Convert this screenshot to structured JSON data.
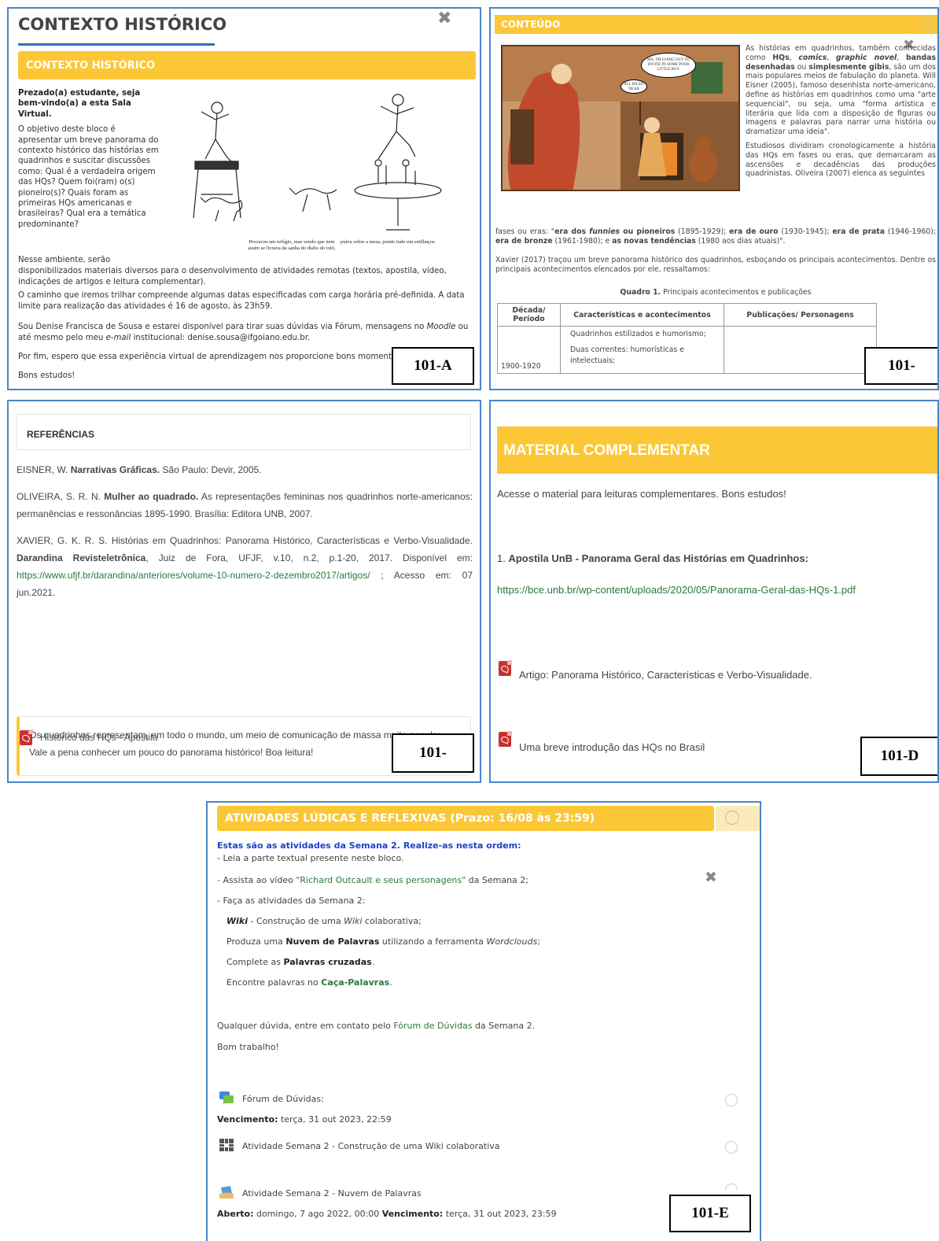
{
  "panel_a": {
    "heading": "CONTEXTO HISTÓRICO",
    "bar_title": "CONTEXTO HISTÓRICO",
    "greeting": "Prezado(a) estudante, seja bem-vindo(a) a esta Sala Virtual.",
    "intro": "O objetivo deste bloco é apresentar um breve panorama do contexto histórico das histórias em quadrinhos e suscitar discussões como: Qual é a verdadeira origem das HQs? Quem foi(ram) o(s) pioneiro(s)? Quais foram as primeiras HQs americanas e brasileiras? Qual era a temática predominante?",
    "para_env_a": "Nesse ambiente, serão",
    "para_env_b": "disponibilizados materiais diversos para o desenvolvimento de atividades remotas (textos, apostila, vídeo, indicações de artigos e leitura complementar).",
    "para_path": "O caminho que iremos trilhar compreende algumas datas especificadas  com carga horária pré-definida. A data limite para realização das atividades é 16 de agosto, às 23h59.",
    "para_me_a": "Sou Denise Francisca de Sousa e estarei disponível para tirar suas dúvidas via Fórum, mensagens no ",
    "para_me_moodle": "Moodle",
    "para_me_b": " ou até mesmo pelo meu ",
    "para_me_email": "e-mail",
    "para_me_c": " institucional: denise.sousa@ifgoiano.edu.br.",
    "para_end": "Por fim, espero que essa experiência virtual de aprendizagem nos proporcione bons momentos.",
    "para_bye": "Bons estudos!",
    "caption_left": "Procurou um refúgio, mas vendo que nem assim se livrava da sanha do diabo do totó,",
    "caption_right": "pulou sobre a mesa, pondo tudo em estilhaços.",
    "tag": "101-A"
  },
  "panel_b": {
    "bar_title": "CONTEÚDO",
    "comic_bubble1": "MA. I'M GOING OUT TO INVITE IN SOME POOR LITTLE BOY.",
    "comic_bubble2": "ALL RIGHT DEAR",
    "p1_a": "As histórias em quadrinhos, também conhecidas como ",
    "p1_hqs": "HQs",
    "p1_comics": "comics",
    "p1_gn": "graphic novel",
    "p1_bd": "bandas desenhadas",
    "p1_or": " ou ",
    "p1_gibis": "simplesmente gibis",
    "p1_b": ", são um dos mais populares meios de fabulação do planeta. Will Eisner (2005), famoso desenhista norte-americano, define as histórias em quadrinhos como uma \"arte sequencial\", ou seja, uma \"forma artística e literária que lida com a disposição de figuras ou imagens e palavras para narrar uma história ou dramatizar uma ideia\".",
    "p2": "Estudiosos dividiram cronologicamente a história das HQs em fases ou eras, que demarcaram as ascensões e decadências das produções quadrinistas. Oliveira (2007) elenca as seguintes",
    "p3_a": "fases ou eras: \"",
    "p3_era1": "era dos ",
    "p3_funnies": "funnies",
    "p3_era1b": " ou pioneiros",
    "p3_y1": " (1895-1929); ",
    "p3_ouro": "era de ouro",
    "p3_y2": " (1930-1945); ",
    "p3_prata": "era de prata",
    "p3_y3": " (1946-1960); ",
    "p3_bronze_a": "era de bronze",
    "p3_y4": " (1961-1980); e ",
    "p3_novas": "as novas tendências",
    "p3_y5": " (1980 aos dias atuais)\".",
    "p4": "Xavier (2017) traçou um breve panorama histórico dos quadrinhos, esboçando os principais acontecimentos. Dentre os principais acontecimentos elencados por ele, ressaltamos:",
    "quadro_label": "Quadro 1.",
    "quadro_title": " Principais acontecimentos e publicações",
    "table_headers": [
      "Década/ Período",
      "Características e acontecimentos",
      "Publicações/ Personagens"
    ],
    "table_period": "1900-1920",
    "table_items": [
      "Quadrinhos estilizados e humorismo;",
      "Duas correntes: humorísticas e intelectuais;"
    ],
    "tag": "101-"
  },
  "panel_c": {
    "ref_heading": "REFERÊNCIAS",
    "ref1_a": "EISNER, W. ",
    "ref1_b": "Narrativas Gráficas.",
    "ref1_c": " São Paulo: Devir, 2005.",
    "ref2_a": "OLIVEIRA, S. R. N. ",
    "ref2_b": "Mulher ao quadrado.",
    "ref2_c": " As representações femininas nos quadrinhos norte-americanos: permanências e ressonâncias 1895-1990. Brasília: Editora UNB, 2007.",
    "ref3_a": "XAVIER, G. K. R. S. Histórias em Quadrinhos: Panorama Histórico, Características e Verbo-Visualidade. ",
    "ref3_b": "Darandina Revisteletrônica",
    "ref3_c": ", Juiz de Fora, UFJF, v.10, n.2, p.1-20, 2017. Disponível em: ",
    "ref3_link": "https://www.ufjf.br/darandina/anteriores/volume-10-numero-2-dezembro2017/artigos/",
    "ref3_d": " ; Acesso em: 07 jun.2021.",
    "note": "Os quadrinhos representam, em todo o mundo, um meio de comunicação de massa muito popular.  Vale a pena conhecer um pouco do panorama histórico! Boa leitura!",
    "resource": "Histórico das HQs - Apostila",
    "tag": "101-"
  },
  "panel_d": {
    "bar_title": "MATERIAL COMPLEMENTAR",
    "intro": "Acesse o material para leituras complementares. Bons estudos!",
    "item1_num": "1. ",
    "item1_title": "Apostila UnB - Panorama Geral das Histórias em Quadrinhos:",
    "item1_link": "https://bce.unb.br/wp-content/uploads/2020/05/Panorama-Geral-das-HQs-1.pdf",
    "resource1": "Artigo: Panorama Histórico, Características e Verbo-Visualidade.",
    "resource2": "Uma breve introdução das HQs no Brasil",
    "tag": "101-D"
  },
  "panel_e": {
    "bar_title": "ATIVIDADES LÚDICAS E REFLEXIVAS (Prazo: 16/08 às 23:59)",
    "heading": "Estas são as atividades da Semana 2. Realize-as nesta ordem:",
    "step1": "- Leia a parte textual presente neste bloco.",
    "step2_a": "- Assista ao vídeo ",
    "step2_link": "\"Richard Outcault e seus personagens\"",
    "step2_b": " da Semana 2;",
    "step3": "- Faça as atividades da Semana 2:",
    "wiki_a": "Wiki",
    "wiki_b": " - Construção de uma ",
    "wiki_c": "Wiki",
    "wiki_d": " colaborativa;",
    "nuvem_a": "Produza uma ",
    "nuvem_b": "Nuvem de Palavras",
    "nuvem_c": " utilizando a ferramenta ",
    "nuvem_d": "Wordclouds",
    "nuvem_e": ";",
    "cruz_a": "Complete as ",
    "cruz_b": "Palavras cruzadas",
    "cruz_c": ".",
    "caca_a": "Encontre palavras no ",
    "caca_b": "Caça-Palavras",
    "caca_c": ".",
    "doubt_a": "Qualquer dúvida, entre em contato pelo ",
    "doubt_link": "Fórum de Dúvidas",
    "doubt_b": " da Semana 2.",
    "bye": "Bom trabalho!",
    "act1": "Fórum de Dúvidas:",
    "act1_due_label": "Vencimento:",
    "act1_due": " terça, 31 out 2023, 22:59",
    "act2": "Atividade Semana 2 - Construção de uma Wiki colaborativa",
    "act3": "Atividade Semana 2 - Nuvem de Palavras",
    "act3_open_label": "Aberto:",
    "act3_open": " domingo, 7 ago 2022, 00:00 ",
    "act3_due_label": "Vencimento:",
    "act3_due": " terça, 31 out 2023, 23:59",
    "tag": "101-E"
  },
  "icons": {
    "close": "close-icon",
    "pdf": "pdf-icon",
    "forum": "forum-icon",
    "wiki": "wiki-icon",
    "assignment": "assignment-icon",
    "completion": "completion-circle-icon"
  },
  "colors": {
    "accent_yellow": "#fcc736",
    "border_blue": "#4a86c5",
    "heading_blue": "#1b44c8",
    "link_green": "#2a7a3a",
    "pdf_red": "#c8312f"
  }
}
